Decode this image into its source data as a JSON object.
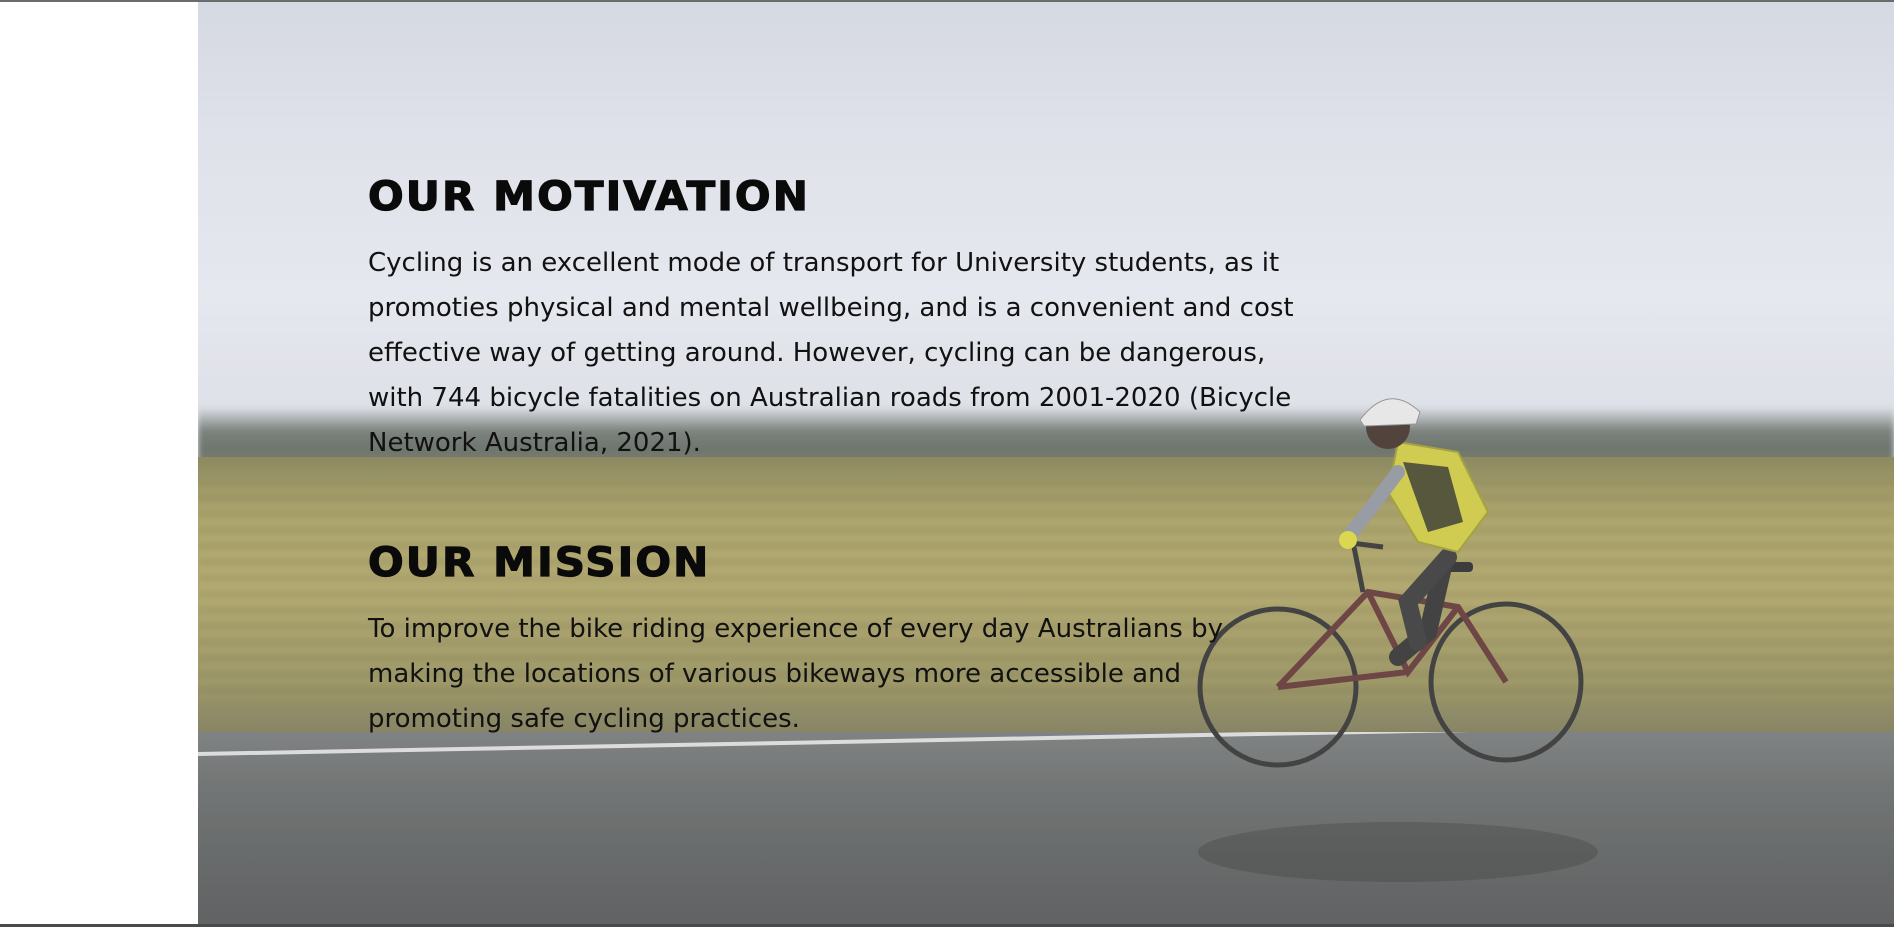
{
  "motivation": {
    "heading": "OUR MOTIVATION",
    "text": "Cycling is an excellent mode of transport for University students, as it promoties physical and mental wellbeing, and is a convenient and cost effective way of getting around. However, cycling can be dangerous, with 744 bicycle fatalities on Australian roads from 2001-2020 (Bicycle Network Australia, 2021)."
  },
  "mission": {
    "heading": "OUR MISSION",
    "text": "To improve the bike riding experience of every day Australians by making the locations of various bikeways more accessible and promoting safe cycling practices."
  },
  "background": {
    "icon": "cyclist-road-photo"
  }
}
